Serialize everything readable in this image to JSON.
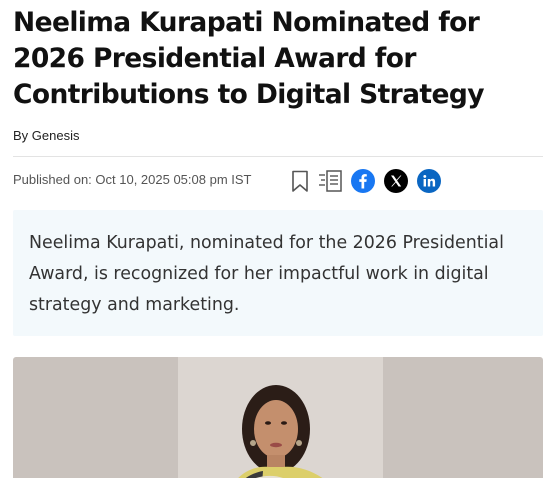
{
  "article": {
    "headline": "Neelima Kurapati Nominated for 2026 Presidential Award for Contributions to Digital Strategy",
    "byline_prefix": "By",
    "author": "Genesis",
    "published": "Published on: Oct 10, 2025 05:08 pm IST",
    "summary": "Neelima Kurapati, nominated for the 2026 Presidential Award, is recognized for her impactful work in digital strategy and marketing."
  },
  "share_icons": [
    {
      "name": "bookmark-icon",
      "color": "#555555"
    },
    {
      "name": "notes-icon",
      "color": "#555555"
    },
    {
      "name": "facebook-icon",
      "color": "#1877f2"
    },
    {
      "name": "x-icon",
      "color": "#000000"
    },
    {
      "name": "linkedin-icon",
      "color": "#0a66c2"
    }
  ],
  "colors": {
    "summary_background": "#f3f9fc",
    "headline": "#111111"
  }
}
